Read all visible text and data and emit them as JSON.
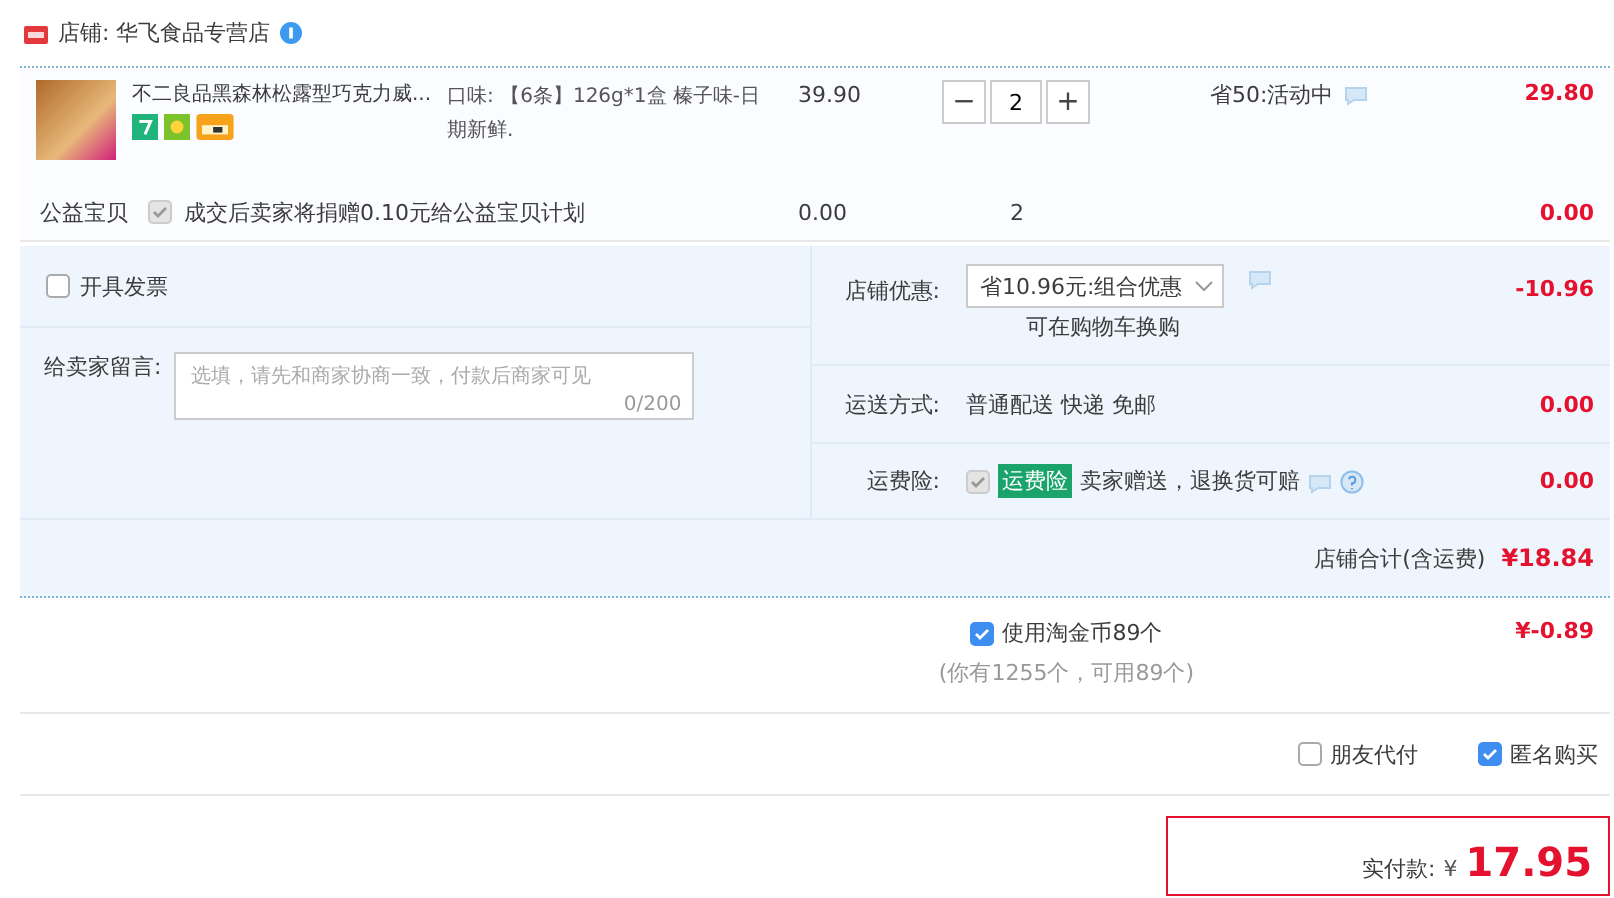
{
  "shop": {
    "name": "店铺: 华飞食品专营店"
  },
  "item": {
    "title": "不二良品黑森林松露型巧克力威...",
    "sku": "口味: 【6条】126g*1盒 榛子味-日期新鲜.",
    "price": "39.90",
    "minus": "−",
    "quantity": "2",
    "plus": "+",
    "promo": "省50:活动中",
    "subtotal": "29.80"
  },
  "charity": {
    "label": "公益宝贝",
    "checked": true,
    "text": "成交后卖家将捐赠0.10元给公益宝贝计划",
    "price": "0.00",
    "quantity": "2",
    "subtotal": "0.00"
  },
  "invoice": {
    "label": "开具发票",
    "checked": false
  },
  "message": {
    "label": "给卖家留言:",
    "placeholder": "选填，请先和商家协商一致，付款后商家可见",
    "counter": "0/200"
  },
  "discount": {
    "label": "店铺优惠:",
    "value": "省10.96元:组合优惠",
    "hint": "可在购物车换购",
    "amount": "-10.96"
  },
  "shipping": {
    "label": "运送方式:",
    "value": "普通配送 快递 免邮",
    "amount": "0.00"
  },
  "insurance": {
    "label": "运费险:",
    "checked": true,
    "badge": "运费险",
    "text": "卖家赠送，退换货可赔",
    "amount": "0.00"
  },
  "shop_total": {
    "label": "店铺合计(含运费)",
    "amount": "¥18.84"
  },
  "coins": {
    "label": "使用淘金币89个",
    "checked": true,
    "note": "(你有1255个，可用89个)",
    "amount": "¥-0.89"
  },
  "options": [
    {
      "label": "朋友代付",
      "checked": false
    },
    {
      "label": "匿名购买",
      "checked": true
    }
  ],
  "payment": {
    "label": "实付款:",
    "currency": "¥",
    "amount": "17.95"
  }
}
